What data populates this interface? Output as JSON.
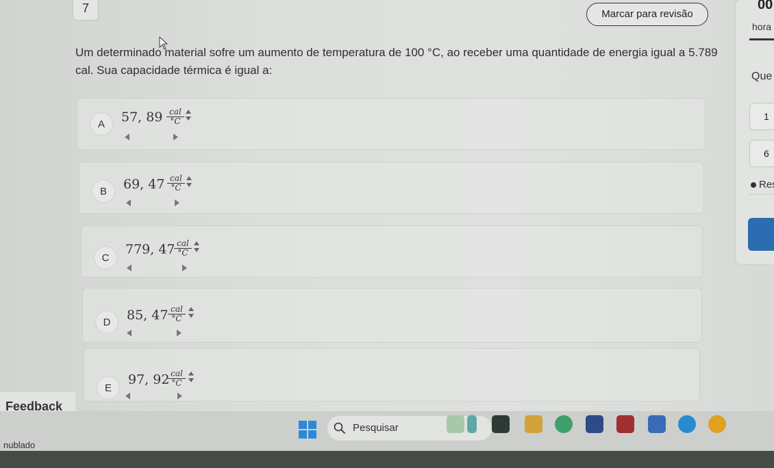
{
  "header": {
    "question_number": "7",
    "review_button_label": "Marcar para revisão"
  },
  "side_panel": {
    "timer": "00",
    "hora_label": "hora",
    "que_label": "Que",
    "box1": "1",
    "box2": "6",
    "res_label": "Res"
  },
  "question": {
    "text": "Um determinado material sofre um aumento de temperatura de 100 °C, ao receber uma quantidade de energia igual a 5.789 cal. Sua capacidade térmica é igual a:"
  },
  "unit": {
    "numerator": "cal",
    "denominator": "°C"
  },
  "options": [
    {
      "letter": "A",
      "value": "57, 89"
    },
    {
      "letter": "B",
      "value": "69, 47"
    },
    {
      "letter": "C",
      "value": "779, 47"
    },
    {
      "letter": "D",
      "value": "85, 47"
    },
    {
      "letter": "E",
      "value": "97, 92"
    }
  ],
  "feedback_label": "Feedback",
  "taskbar": {
    "search_label": "Pesquisar",
    "weather": "nublado"
  },
  "colors": {
    "accent_blue": "#2c6cb0",
    "page_bg": "#dcdedc"
  }
}
